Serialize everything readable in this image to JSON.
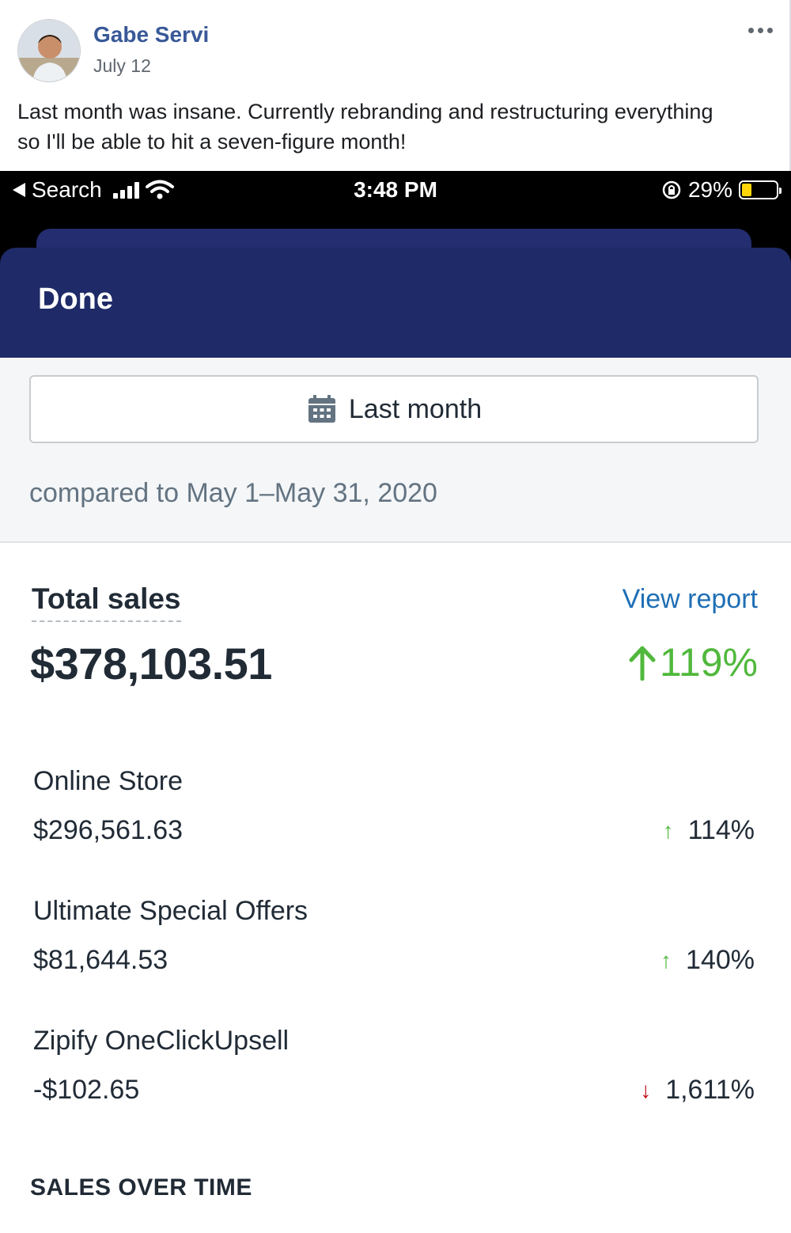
{
  "post": {
    "author": "Gabe Servi",
    "date": "July 12",
    "text": "Last month was insane. Currently rebranding and restructuring everything so I'll be able to hit a seven-figure month!"
  },
  "phone": {
    "status": {
      "back_label": "Search",
      "time": "3:48 PM",
      "battery": "29%",
      "battery_level": 0.29
    },
    "nav": {
      "done_label": "Done"
    },
    "filter": {
      "date_range_label": "Last month",
      "compare_text": "compared to May 1–May 31, 2020"
    },
    "total_sales": {
      "label": "Total sales",
      "view_report": "View report",
      "value": "$378,103.51",
      "change": "119%",
      "direction": "up"
    },
    "channels": [
      {
        "name": "Online Store",
        "amount": "$296,561.63",
        "arrow": "↑",
        "change": "114%",
        "direction": "up"
      },
      {
        "name": "Ultimate Special Offers",
        "amount": "$81,644.53",
        "arrow": "↑",
        "change": "140%",
        "direction": "up"
      },
      {
        "name": "Zipify OneClickUpsell",
        "amount": "-$102.65",
        "arrow": "↓",
        "change": "1,611%",
        "direction": "down"
      }
    ],
    "sales_over_time_heading": "SALES OVER TIME"
  },
  "colors": {
    "nav_bg": "#1f2a68",
    "positive": "#50b83c",
    "negative": "#bf0711",
    "link": "#1f6fb5",
    "fb_name": "#385898"
  }
}
